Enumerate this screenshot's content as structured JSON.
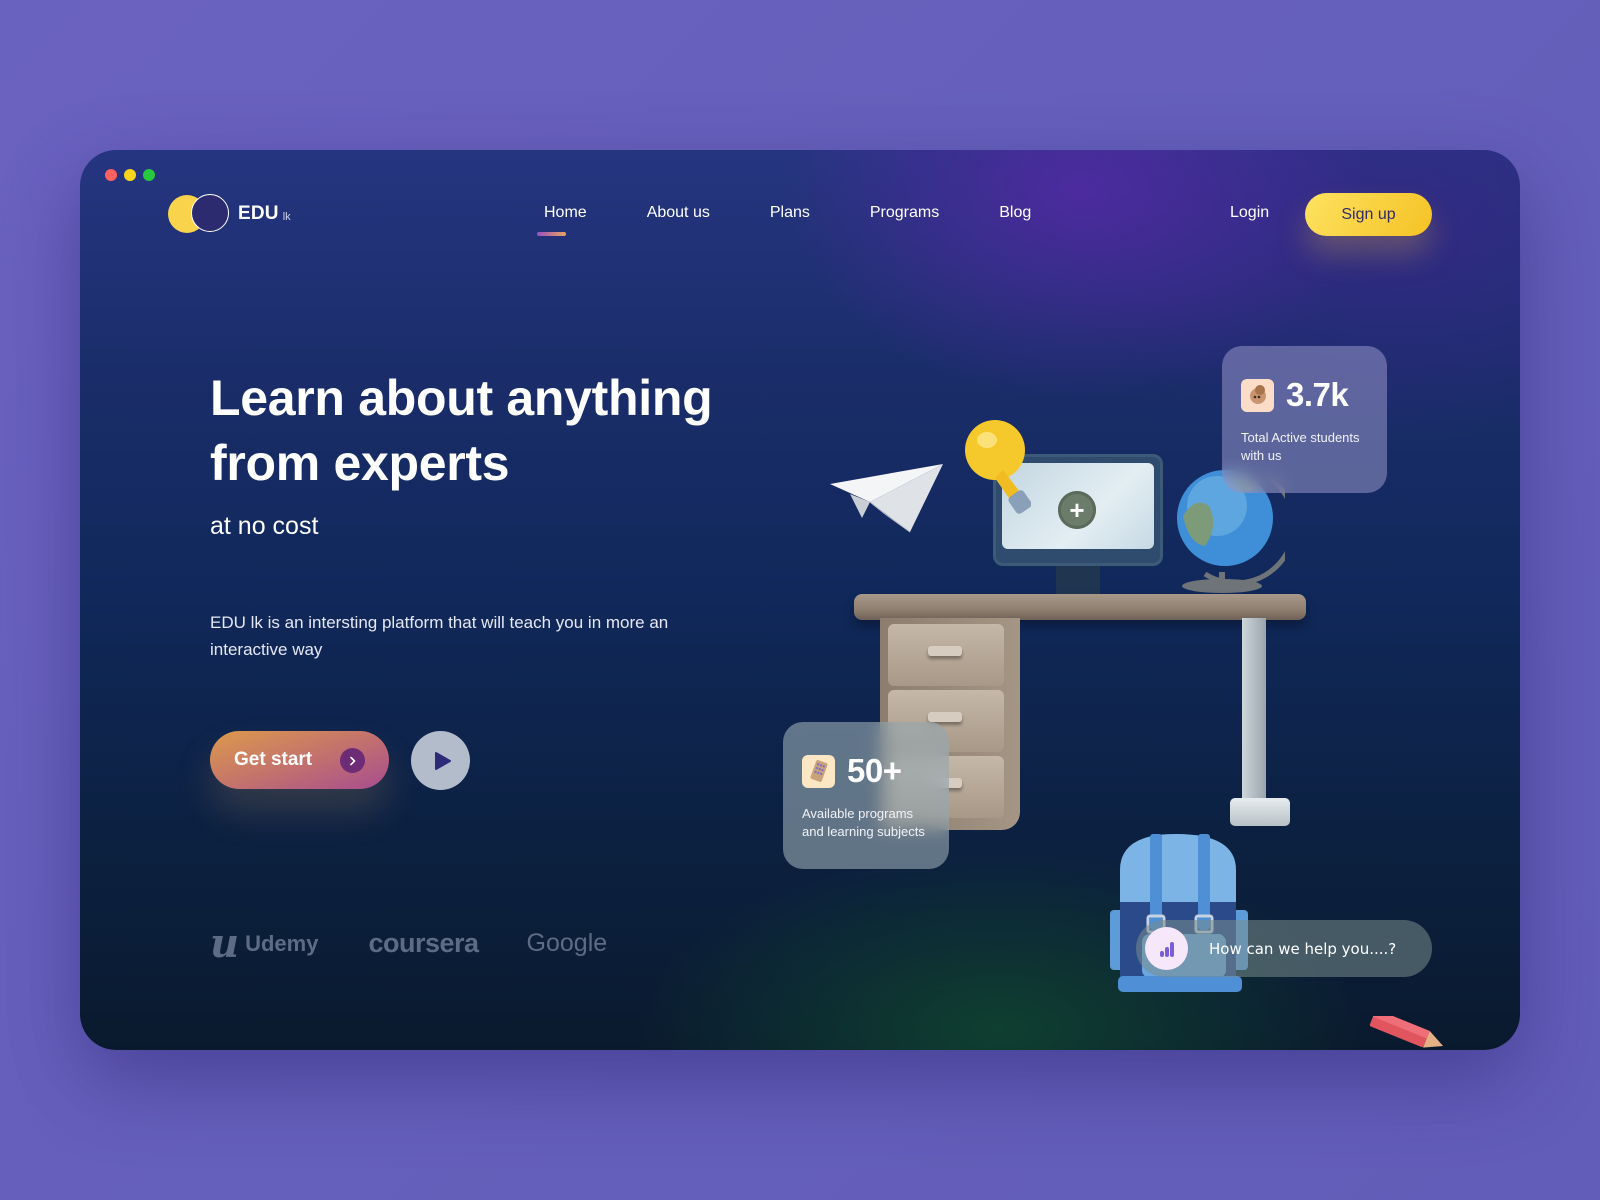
{
  "window": {
    "traffic_lights": [
      "close",
      "minimize",
      "maximize"
    ]
  },
  "brand": {
    "name": "EDU",
    "suffix": "lk"
  },
  "nav": {
    "items": [
      {
        "label": "Home",
        "active": true
      },
      {
        "label": "About us",
        "active": false
      },
      {
        "label": "Plans",
        "active": false
      },
      {
        "label": "Programs",
        "active": false
      },
      {
        "label": "Blog",
        "active": false
      }
    ],
    "login_label": "Login",
    "signup_label": "Sign up"
  },
  "hero": {
    "title_line1": "Learn about anything",
    "title_line2": "from experts",
    "subtitle": "at no cost",
    "description": "EDU lk is an intersting platform that will teach you in more an interactive way",
    "cta_label": "Get start",
    "cta_icon": "chevron-right-icon",
    "play_icon": "play-icon"
  },
  "partners": [
    {
      "name": "Udemy",
      "mark": "u"
    },
    {
      "name": "coursera"
    },
    {
      "name": "Google"
    }
  ],
  "stats": [
    {
      "value": "3.7k",
      "label": "Total Active students with us",
      "icon": "student-avatar-icon"
    },
    {
      "value": "50+",
      "label": "Available programs and learning subjects",
      "icon": "calculator-icon"
    }
  ],
  "help": {
    "text": "How can we help you....?",
    "icon": "bar-chart-icon"
  },
  "colors": {
    "page_bg": "#6a62bf",
    "accent_yellow": "#f9d34c",
    "signup_text": "#2e2a68",
    "cta_start": "#dc9a4c",
    "cta_end": "#a84d8f",
    "nav_underline_start": "#9a4fc1",
    "nav_underline_end": "#e8a35e"
  }
}
